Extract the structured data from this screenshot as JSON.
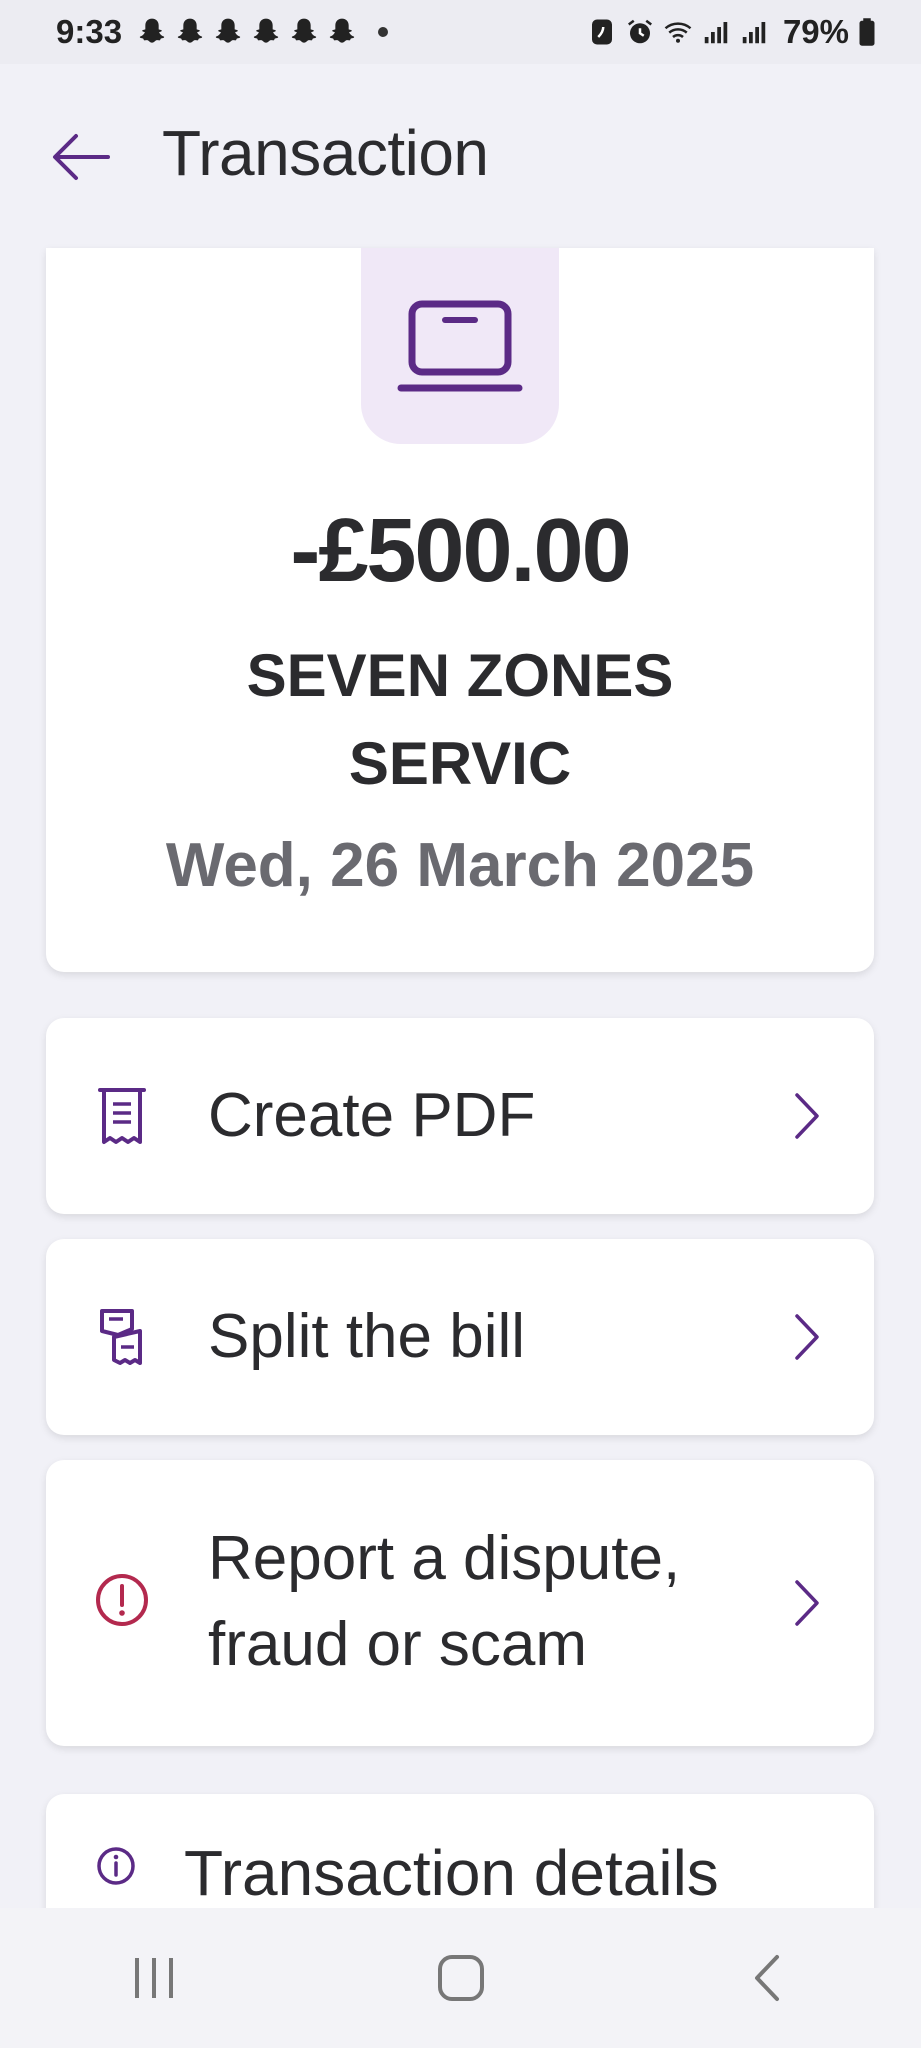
{
  "status_bar": {
    "time": "9:33",
    "notification_icons": [
      "snapchat-icon",
      "snapchat-icon",
      "snapchat-icon",
      "snapchat-icon",
      "snapchat-icon",
      "snapchat-icon"
    ],
    "battery": "79%"
  },
  "header": {
    "title": "Transaction",
    "back_icon": "arrow-left-icon"
  },
  "transaction": {
    "icon": "laptop-icon",
    "amount": "-£500.00",
    "merchant": "SEVEN ZONES SERVIC",
    "date": "Wed, 26 March 2025"
  },
  "actions": [
    {
      "label": "Create PDF",
      "icon": "receipt-icon"
    },
    {
      "label": "Split the bill",
      "icon": "split-bill-icon"
    },
    {
      "label": "Report a dispute, fraud or scam",
      "icon": "alert-circle-icon"
    }
  ],
  "details": {
    "title": "Transaction details",
    "icon": "info-icon"
  },
  "colors": {
    "accent": "#5b2a86",
    "alert": "#b3294e",
    "background": "#f1f1f7",
    "icon_bg": "#f0e8f7"
  }
}
